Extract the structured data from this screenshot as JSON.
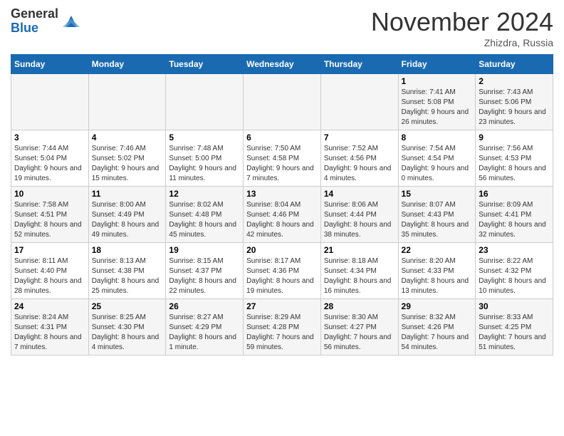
{
  "logo": {
    "general": "General",
    "blue": "Blue"
  },
  "title": "November 2024",
  "location": "Zhizdra, Russia",
  "days_header": [
    "Sunday",
    "Monday",
    "Tuesday",
    "Wednesday",
    "Thursday",
    "Friday",
    "Saturday"
  ],
  "weeks": [
    [
      {
        "num": "",
        "info": ""
      },
      {
        "num": "",
        "info": ""
      },
      {
        "num": "",
        "info": ""
      },
      {
        "num": "",
        "info": ""
      },
      {
        "num": "",
        "info": ""
      },
      {
        "num": "1",
        "info": "Sunrise: 7:41 AM\nSunset: 5:08 PM\nDaylight: 9 hours and 26 minutes."
      },
      {
        "num": "2",
        "info": "Sunrise: 7:43 AM\nSunset: 5:06 PM\nDaylight: 9 hours and 23 minutes."
      }
    ],
    [
      {
        "num": "3",
        "info": "Sunrise: 7:44 AM\nSunset: 5:04 PM\nDaylight: 9 hours and 19 minutes."
      },
      {
        "num": "4",
        "info": "Sunrise: 7:46 AM\nSunset: 5:02 PM\nDaylight: 9 hours and 15 minutes."
      },
      {
        "num": "5",
        "info": "Sunrise: 7:48 AM\nSunset: 5:00 PM\nDaylight: 9 hours and 11 minutes."
      },
      {
        "num": "6",
        "info": "Sunrise: 7:50 AM\nSunset: 4:58 PM\nDaylight: 9 hours and 7 minutes."
      },
      {
        "num": "7",
        "info": "Sunrise: 7:52 AM\nSunset: 4:56 PM\nDaylight: 9 hours and 4 minutes."
      },
      {
        "num": "8",
        "info": "Sunrise: 7:54 AM\nSunset: 4:54 PM\nDaylight: 9 hours and 0 minutes."
      },
      {
        "num": "9",
        "info": "Sunrise: 7:56 AM\nSunset: 4:53 PM\nDaylight: 8 hours and 56 minutes."
      }
    ],
    [
      {
        "num": "10",
        "info": "Sunrise: 7:58 AM\nSunset: 4:51 PM\nDaylight: 8 hours and 52 minutes."
      },
      {
        "num": "11",
        "info": "Sunrise: 8:00 AM\nSunset: 4:49 PM\nDaylight: 8 hours and 49 minutes."
      },
      {
        "num": "12",
        "info": "Sunrise: 8:02 AM\nSunset: 4:48 PM\nDaylight: 8 hours and 45 minutes."
      },
      {
        "num": "13",
        "info": "Sunrise: 8:04 AM\nSunset: 4:46 PM\nDaylight: 8 hours and 42 minutes."
      },
      {
        "num": "14",
        "info": "Sunrise: 8:06 AM\nSunset: 4:44 PM\nDaylight: 8 hours and 38 minutes."
      },
      {
        "num": "15",
        "info": "Sunrise: 8:07 AM\nSunset: 4:43 PM\nDaylight: 8 hours and 35 minutes."
      },
      {
        "num": "16",
        "info": "Sunrise: 8:09 AM\nSunset: 4:41 PM\nDaylight: 8 hours and 32 minutes."
      }
    ],
    [
      {
        "num": "17",
        "info": "Sunrise: 8:11 AM\nSunset: 4:40 PM\nDaylight: 8 hours and 28 minutes."
      },
      {
        "num": "18",
        "info": "Sunrise: 8:13 AM\nSunset: 4:38 PM\nDaylight: 8 hours and 25 minutes."
      },
      {
        "num": "19",
        "info": "Sunrise: 8:15 AM\nSunset: 4:37 PM\nDaylight: 8 hours and 22 minutes."
      },
      {
        "num": "20",
        "info": "Sunrise: 8:17 AM\nSunset: 4:36 PM\nDaylight: 8 hours and 19 minutes."
      },
      {
        "num": "21",
        "info": "Sunrise: 8:18 AM\nSunset: 4:34 PM\nDaylight: 8 hours and 16 minutes."
      },
      {
        "num": "22",
        "info": "Sunrise: 8:20 AM\nSunset: 4:33 PM\nDaylight: 8 hours and 13 minutes."
      },
      {
        "num": "23",
        "info": "Sunrise: 8:22 AM\nSunset: 4:32 PM\nDaylight: 8 hours and 10 minutes."
      }
    ],
    [
      {
        "num": "24",
        "info": "Sunrise: 8:24 AM\nSunset: 4:31 PM\nDaylight: 8 hours and 7 minutes."
      },
      {
        "num": "25",
        "info": "Sunrise: 8:25 AM\nSunset: 4:30 PM\nDaylight: 8 hours and 4 minutes."
      },
      {
        "num": "26",
        "info": "Sunrise: 8:27 AM\nSunset: 4:29 PM\nDaylight: 8 hours and 1 minute."
      },
      {
        "num": "27",
        "info": "Sunrise: 8:29 AM\nSunset: 4:28 PM\nDaylight: 7 hours and 59 minutes."
      },
      {
        "num": "28",
        "info": "Sunrise: 8:30 AM\nSunset: 4:27 PM\nDaylight: 7 hours and 56 minutes."
      },
      {
        "num": "29",
        "info": "Sunrise: 8:32 AM\nSunset: 4:26 PM\nDaylight: 7 hours and 54 minutes."
      },
      {
        "num": "30",
        "info": "Sunrise: 8:33 AM\nSunset: 4:25 PM\nDaylight: 7 hours and 51 minutes."
      }
    ]
  ]
}
